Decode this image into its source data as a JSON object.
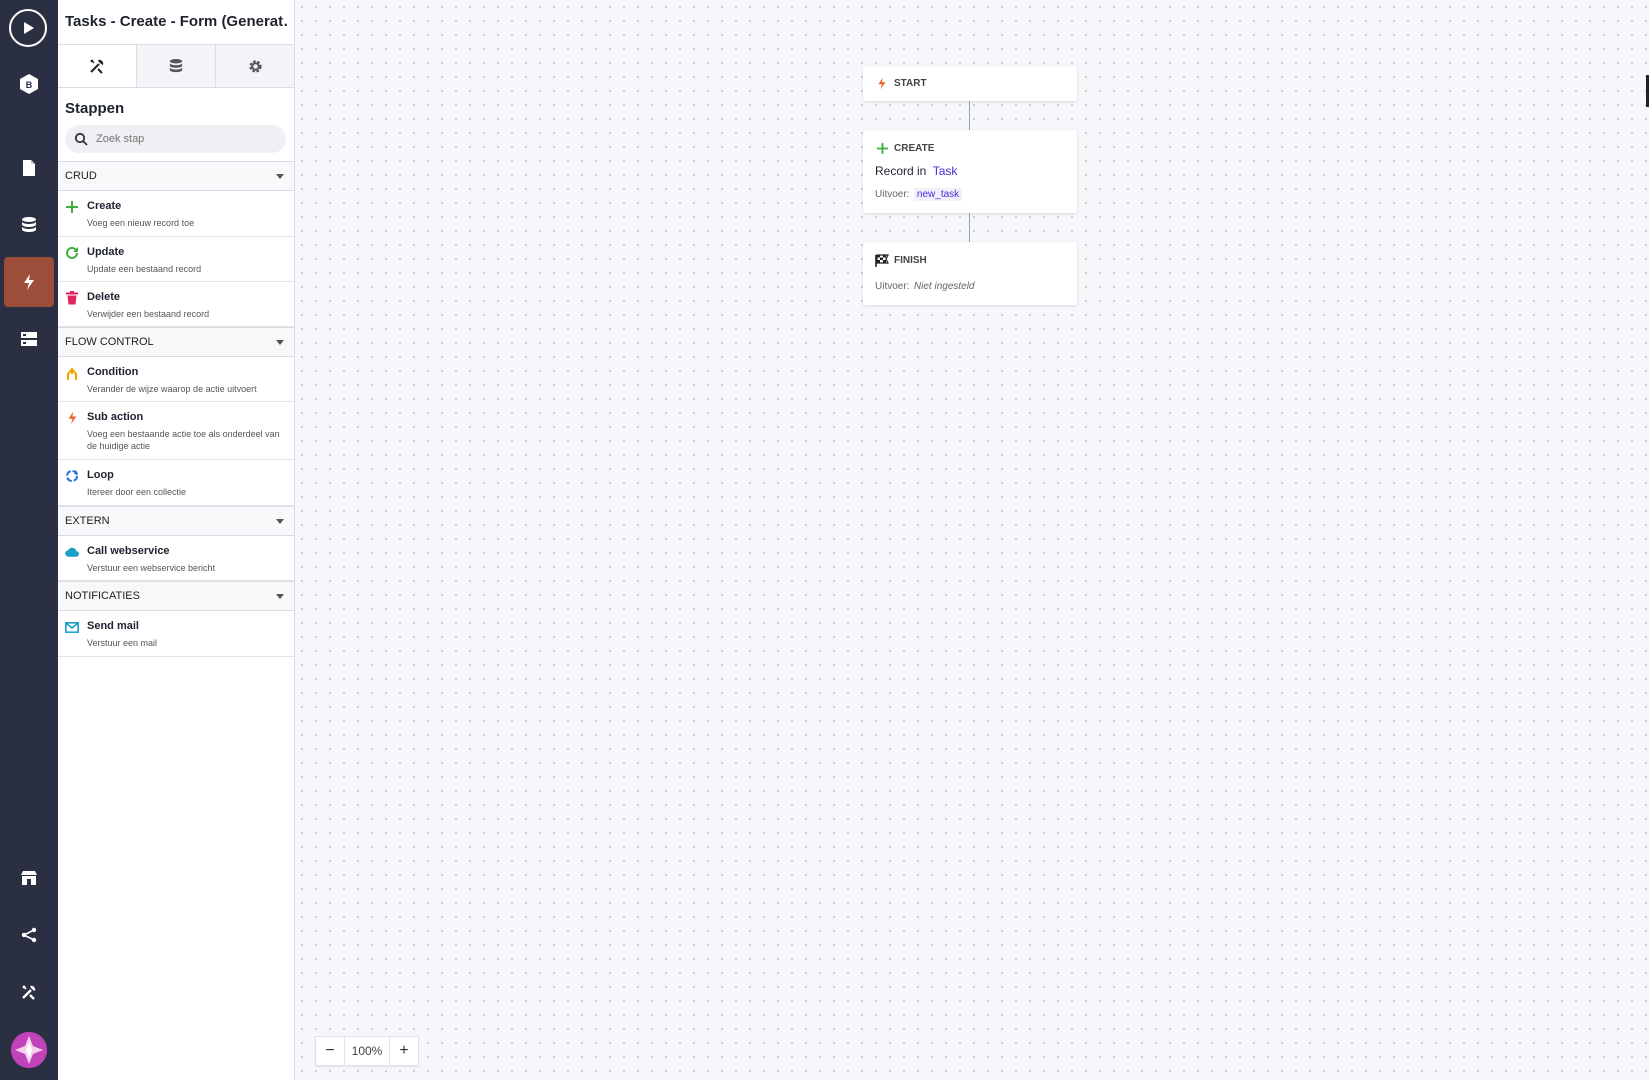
{
  "panel": {
    "title": "Tasks - Create - Form (Generat…",
    "section_title": "Stappen",
    "search_placeholder": "Zoek stap"
  },
  "groups": {
    "crud": "CRUD",
    "flow": "FLOW CONTROL",
    "extern": "EXTERN",
    "notif": "NOTIFICATIES"
  },
  "steps": {
    "create": {
      "title": "Create",
      "desc": "Voeg een nieuw record toe"
    },
    "update": {
      "title": "Update",
      "desc": "Update een bestaand record"
    },
    "delete": {
      "title": "Delete",
      "desc": "Verwijder een bestaand record"
    },
    "condition": {
      "title": "Condition",
      "desc": "Verander de wijze waarop de actie uitvoert"
    },
    "subaction": {
      "title": "Sub action",
      "desc": "Voeg een bestaande actie toe als onderdeel van de huidige actie"
    },
    "loop": {
      "title": "Loop",
      "desc": "Itereer door een collectie"
    },
    "webservice": {
      "title": "Call webservice",
      "desc": "Verstuur een webservice bericht"
    },
    "sendmail": {
      "title": "Send mail",
      "desc": "Verstuur een mail"
    }
  },
  "flow": {
    "start_label": "START",
    "create_label": "CREATE",
    "record_in": "Record in",
    "record_model": "Task",
    "output_label": "Uitvoer:",
    "output_value": "new_task",
    "finish_label": "FINISH",
    "finish_output_label": "Uitvoer:",
    "finish_output_value": "Niet ingesteld"
  },
  "zoom": {
    "minus": "−",
    "level": "100%",
    "plus": "+"
  },
  "rail": {
    "brand_letter": "B"
  },
  "colors": {
    "rail_bg": "#2b2f42",
    "rail_active": "#9c4e3a",
    "accent_link": "#4b2bd8",
    "success": "#3fae3f"
  }
}
